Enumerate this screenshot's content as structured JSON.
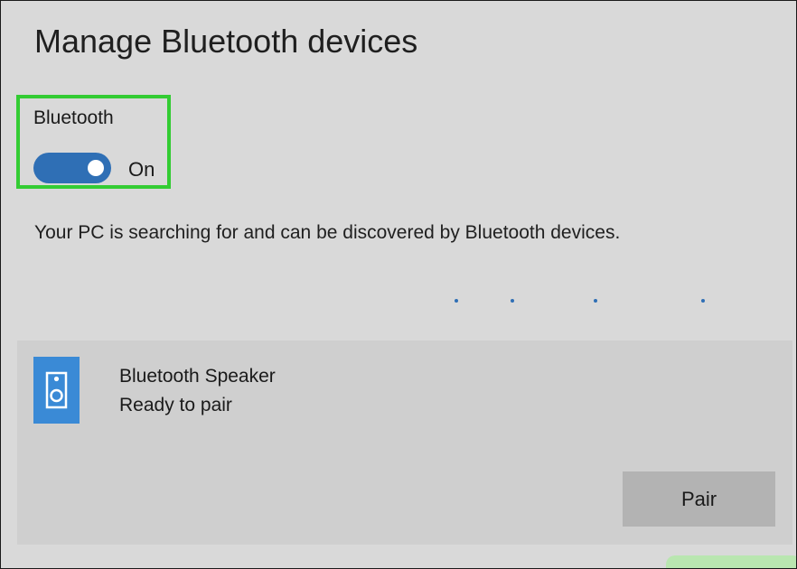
{
  "page": {
    "title": "Manage Bluetooth devices"
  },
  "bluetooth": {
    "label": "Bluetooth",
    "toggle_state": "On",
    "toggle_on": true,
    "accent_color": "#2f6fb5",
    "highlight_color": "#33cc33"
  },
  "discovery": {
    "message": "Your PC is searching for and can be discovered by Bluetooth devices."
  },
  "devices": [
    {
      "name": "Bluetooth Speaker",
      "status": "Ready to pair",
      "icon": "speaker-icon",
      "icon_color": "#3a8ad6",
      "action_label": "Pair"
    }
  ]
}
